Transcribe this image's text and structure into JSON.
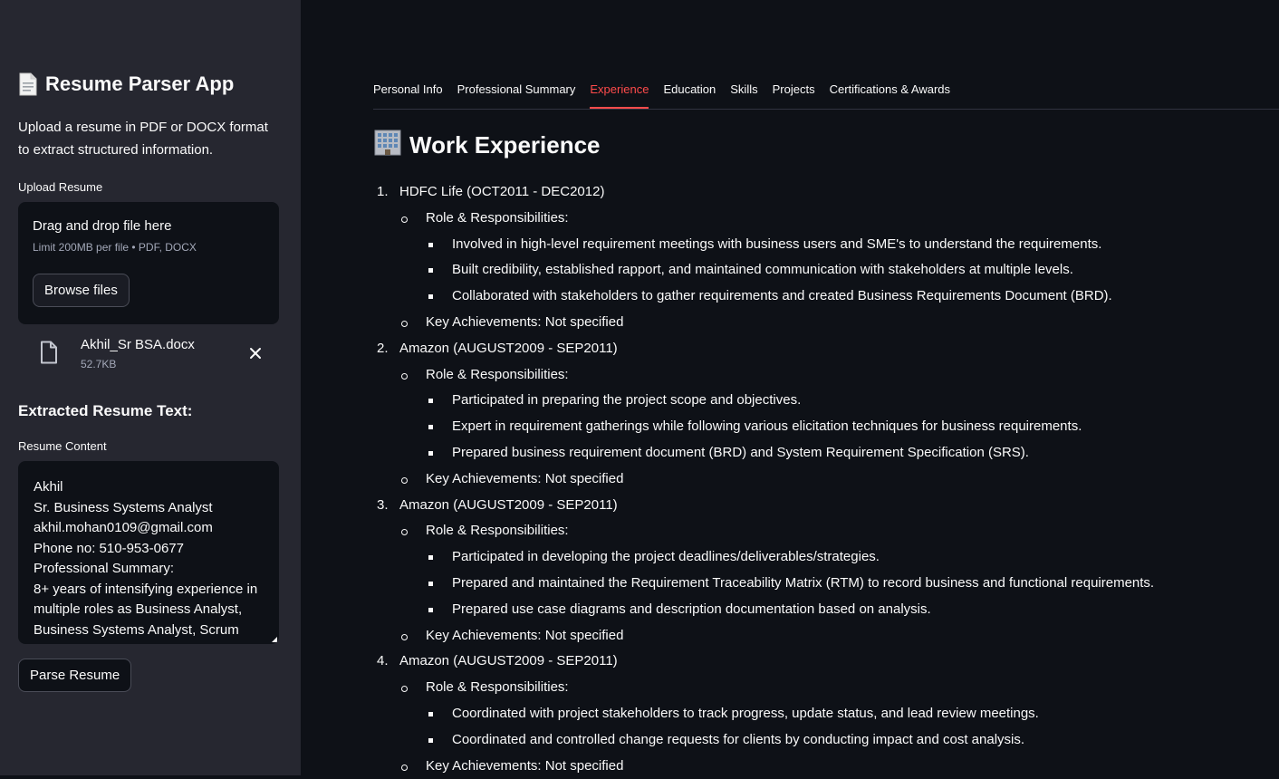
{
  "sidebar": {
    "app_title": "Resume Parser App",
    "app_description": "Upload a resume in PDF or DOCX format to extract structured information.",
    "upload_label": "Upload Resume",
    "dropzone": {
      "title": "Drag and drop file here",
      "limit": "Limit 200MB per file • PDF, DOCX",
      "browse_label": "Browse files"
    },
    "uploaded_file": {
      "name": "Akhil_Sr BSA.docx",
      "size": "52.7KB"
    },
    "extracted_heading": "Extracted Resume Text:",
    "resume_content_label": "Resume Content",
    "resume_content_lines": [
      "Akhil",
      "Sr. Business Systems Analyst",
      "akhil.mohan0109@gmail.com",
      "Phone no: 510-953-0677",
      "Professional Summary:",
      "8+ years of intensifying experience in",
      "multiple roles as Business Analyst,",
      "Business Systems Analyst, Scrum"
    ],
    "parse_button_label": "Parse Resume"
  },
  "tabs": [
    {
      "label": "Personal Info",
      "active": false
    },
    {
      "label": "Professional Summary",
      "active": false
    },
    {
      "label": "Experience",
      "active": true
    },
    {
      "label": "Education",
      "active": false
    },
    {
      "label": "Skills",
      "active": false
    },
    {
      "label": "Projects",
      "active": false
    },
    {
      "label": "Certifications & Awards",
      "active": false
    }
  ],
  "main": {
    "title": "Work Experience",
    "roles_label": "Role & Responsibilities:",
    "achievements_label": "Key Achievements: Not specified",
    "jobs": [
      {
        "number": "1.",
        "heading": "HDFC Life (OCT2011 - DEC2012)",
        "responsibilities": [
          "Involved in high-level requirement meetings with business users and SME's to understand the requirements.",
          "Built credibility, established rapport, and maintained communication with stakeholders at multiple levels.",
          "Collaborated with stakeholders to gather requirements and created Business Requirements Document (BRD)."
        ]
      },
      {
        "number": "2.",
        "heading": "Amazon (AUGUST2009 - SEP2011)",
        "responsibilities": [
          "Participated in preparing the project scope and objectives.",
          "Expert in requirement gatherings while following various elicitation techniques for business requirements.",
          "Prepared business requirement document (BRD) and System Requirement Specification (SRS)."
        ]
      },
      {
        "number": "3.",
        "heading": "Amazon (AUGUST2009 - SEP2011)",
        "responsibilities": [
          "Participated in developing the project deadlines/deliverables/strategies.",
          "Prepared and maintained the Requirement Traceability Matrix (RTM) to record business and functional requirements.",
          "Prepared use case diagrams and description documentation based on analysis."
        ]
      },
      {
        "number": "4.",
        "heading": "Amazon (AUGUST2009 - SEP2011)",
        "responsibilities": [
          "Coordinated with project stakeholders to track progress, update status, and lead review meetings.",
          "Coordinated and controlled change requests for clients by conducting impact and cost analysis."
        ]
      }
    ]
  },
  "colors": {
    "background": "#0e1117",
    "sidebar": "#262730",
    "accent": "#ff4b4b",
    "text": "#fafafa",
    "muted": "#a3a8b8"
  },
  "icons": {
    "app_title_icon": "document-icon",
    "page_title_icon": "office-building-icon",
    "file_icon": "file-icon",
    "close_icon": "close-icon"
  }
}
